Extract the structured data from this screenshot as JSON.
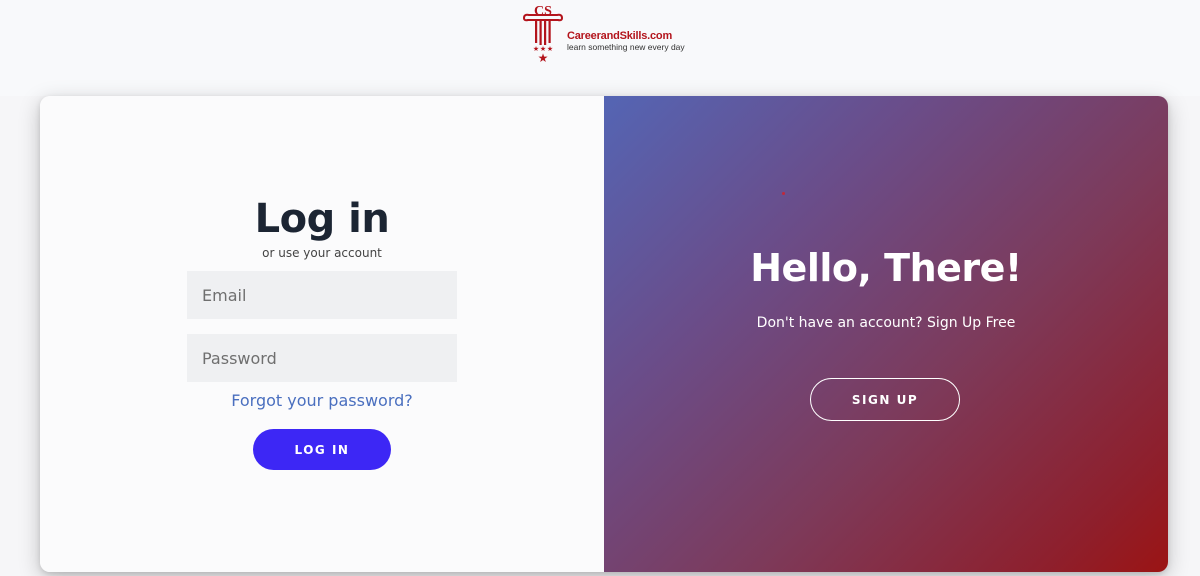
{
  "logo": {
    "mark_text": "CS",
    "name": "CareerandSkills.com",
    "tagline": "learn something new every day"
  },
  "login": {
    "title": "Log in",
    "subtitle": "or use your account",
    "email_placeholder": "Email",
    "password_placeholder": "Password",
    "forgot_link": "Forgot your password?",
    "button_label": "LOG IN"
  },
  "signup": {
    "heading": "Hello, There!",
    "text": "Don't have an account? Sign Up Free",
    "button_label": "SIGN UP"
  },
  "colors": {
    "brand_red": "#b3141c",
    "login_button": "#3d27f5",
    "link": "#4a6fbf",
    "gradient_start": "#5465b4",
    "gradient_end": "#9b1414"
  }
}
